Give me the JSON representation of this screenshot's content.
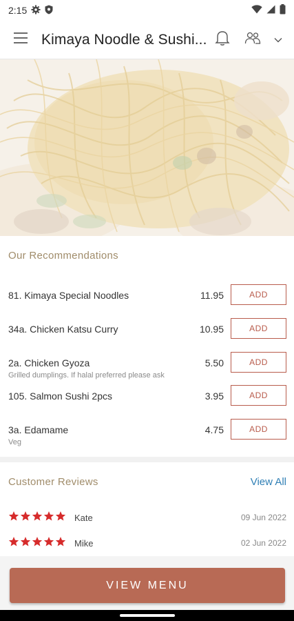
{
  "status_bar": {
    "time": "2:15"
  },
  "app_bar": {
    "title": "Kimaya Noodle & Sushi..."
  },
  "recommendations": {
    "title": "Our Recommendations",
    "add_label": "ADD",
    "items": [
      {
        "name": "81. Kimaya Special Noodles",
        "desc": "",
        "price": "11.95"
      },
      {
        "name": "34a. Chicken Katsu Curry",
        "desc": "",
        "price": "10.95"
      },
      {
        "name": "2a. Chicken Gyoza",
        "desc": "Grilled dumplings. If halal preferred please ask",
        "price": "5.50"
      },
      {
        "name": "105. Salmon Sushi 2pcs",
        "desc": "",
        "price": "3.95"
      },
      {
        "name": "3a. Edamame",
        "desc": "Veg",
        "price": "4.75"
      }
    ]
  },
  "reviews": {
    "title": "Customer Reviews",
    "view_all": "View All",
    "items": [
      {
        "name": "Kate",
        "date": "09 Jun 2022",
        "rating": 5
      },
      {
        "name": "Mike",
        "date": "02 Jun 2022",
        "rating": 5
      }
    ]
  },
  "footer": {
    "view_menu": "VIEW MENU"
  },
  "colors": {
    "accent": "#b85b4b",
    "section_title": "#a08c6a",
    "link": "#2f7fb5",
    "star": "#d62b2b"
  }
}
